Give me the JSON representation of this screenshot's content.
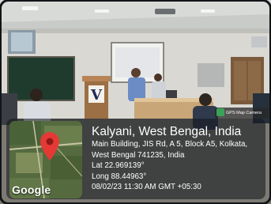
{
  "badge": {
    "label": "GPS Map Camera",
    "icon": "gps-map-camera-app-icon"
  },
  "map": {
    "brand": "Google",
    "marker_icon": "location-pin-icon",
    "marker_color": "#e53935"
  },
  "location": {
    "title": "Kalyani, West Bengal, India",
    "address_line1": "Main Building, JIS Rd, A 5, Block A5, Kolkata,",
    "address_line2": "West Bengal 741235, India",
    "lat": "Lat 22.969139°",
    "long": "Long 88.44963°",
    "timestamp": "08/02/23 11:30 AM GMT +05:30"
  },
  "scene": {
    "banner_letter": "V"
  }
}
